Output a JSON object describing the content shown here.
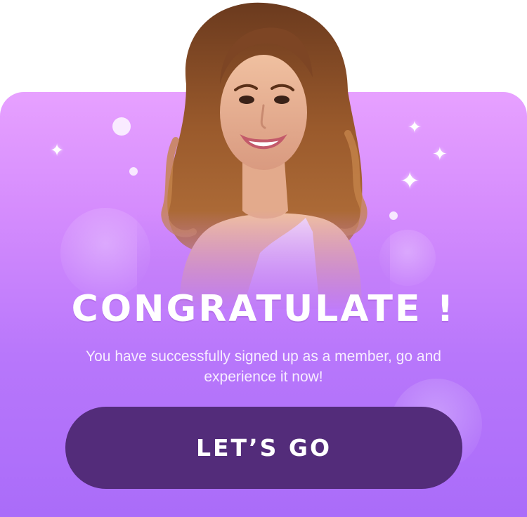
{
  "dialog": {
    "title": "CONGRATULATE !",
    "message": "You have successfully signed up as a member, go and experience it now!",
    "cta_label": "LET’S GO"
  },
  "icons": {
    "sparkle": "✦"
  },
  "colors": {
    "card_top": "#e7a1ff",
    "card_bottom": "#aa6cf9",
    "button_bg": "#532c7a",
    "text": "#ffffff"
  }
}
